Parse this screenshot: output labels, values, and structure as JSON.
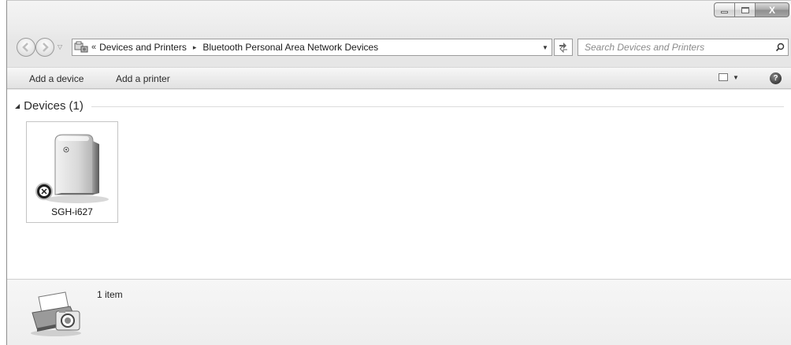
{
  "window": {
    "caption_buttons": {
      "minimize": "",
      "maximize": "",
      "close": "X"
    }
  },
  "nav": {
    "back_icon": "back-arrow-icon",
    "forward_icon": "forward-arrow-icon"
  },
  "address": {
    "overflow_chevrons": "«",
    "breadcrumbs": [
      "Devices and Printers",
      "Bluetooth Personal Area Network Devices"
    ],
    "separator": "▸"
  },
  "search": {
    "placeholder": "Search Devices and Printers"
  },
  "toolbar": {
    "add_device_label": "Add a device",
    "add_printer_label": "Add a printer",
    "help_label": "?"
  },
  "group": {
    "title": "Devices",
    "count": "(1)"
  },
  "devices": [
    {
      "label": "SGH-i627",
      "icon": "bluetooth-device-icon"
    }
  ],
  "details": {
    "item_count": "1 item",
    "icon": "devices-and-printers-icon"
  },
  "colors": {
    "window_chrome": "#e6e6e6",
    "content_bg": "#ffffff",
    "tile_border": "#c4c4c4"
  }
}
